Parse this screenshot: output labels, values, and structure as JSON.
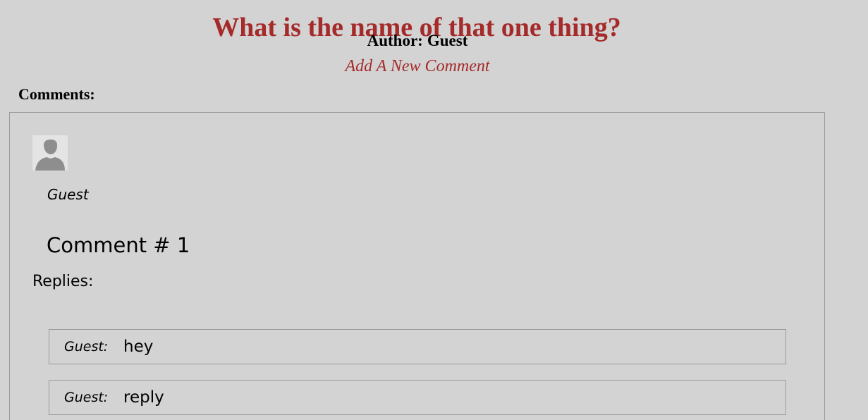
{
  "post": {
    "title": "What is the name of that one thing?",
    "author_label": "Author:",
    "author_name": "Guest",
    "add_comment_label": "Add A New Comment"
  },
  "comments": {
    "heading": "Comments:",
    "items": [
      {
        "avatar_icon": "default-user-avatar-icon",
        "author": "Guest",
        "text": "Comment # 1",
        "replies_heading": "Replies:",
        "replies": [
          {
            "author": "Guest:",
            "text": "hey"
          },
          {
            "author": "Guest:",
            "text": "reply"
          }
        ]
      }
    ]
  },
  "colors": {
    "background": "#d3d3d3",
    "accent": "#a52a2a",
    "border": "#9a9a9a"
  }
}
